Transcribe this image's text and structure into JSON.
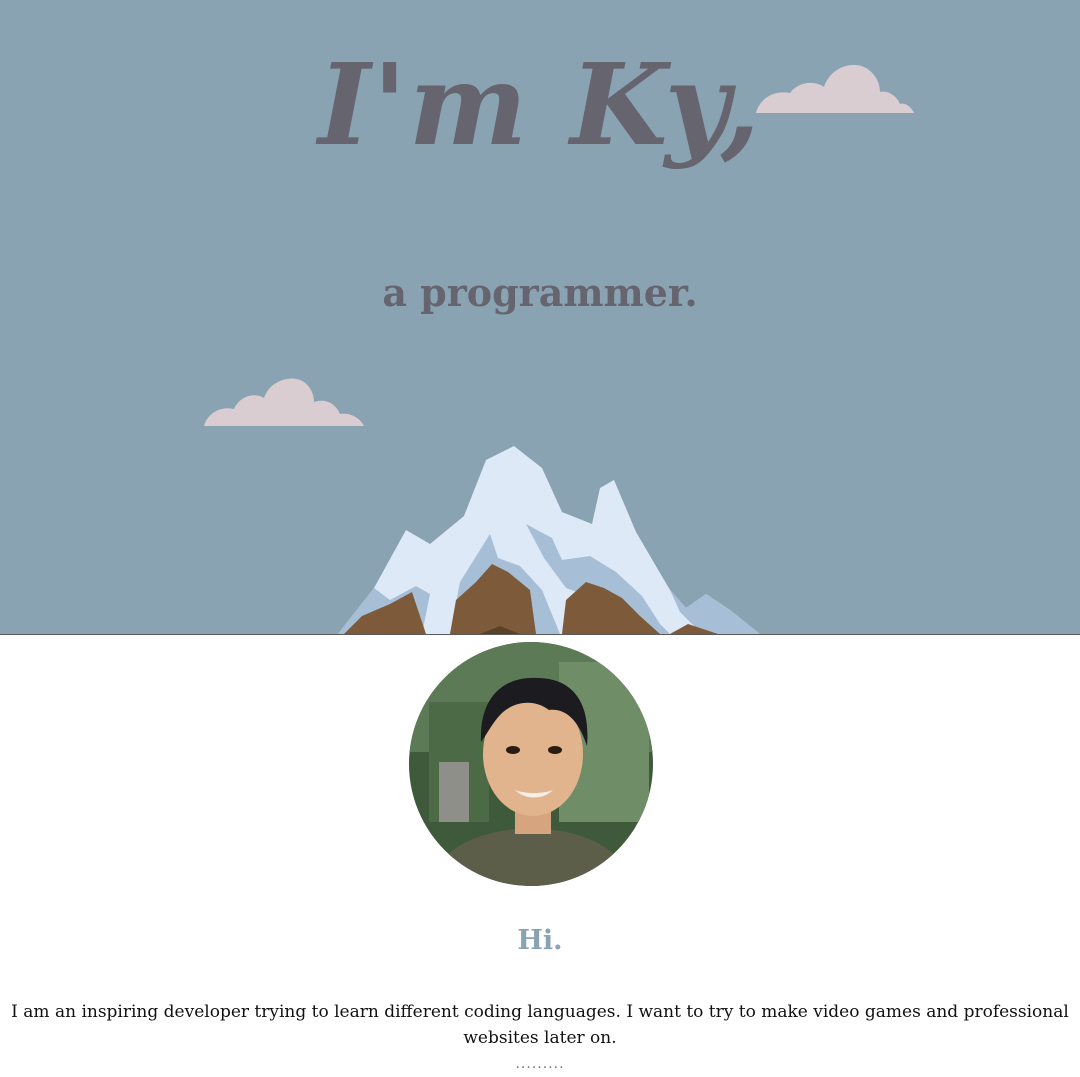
{
  "hero": {
    "title": "I'm Ky,",
    "subtitle": "a programmer."
  },
  "about": {
    "heading": "Hi.",
    "text": "I am an inspiring developer trying to learn different coding languages. I want to try to make video games and professional websites later on.",
    "divider": "........."
  },
  "colors": {
    "hero_background": "#89a3b2",
    "title_text": "#66646f",
    "cloud": "#d9cdd2",
    "snow": "#dde9f7",
    "rock": "#7d5b3a",
    "heading_accent": "#89a3b2"
  }
}
